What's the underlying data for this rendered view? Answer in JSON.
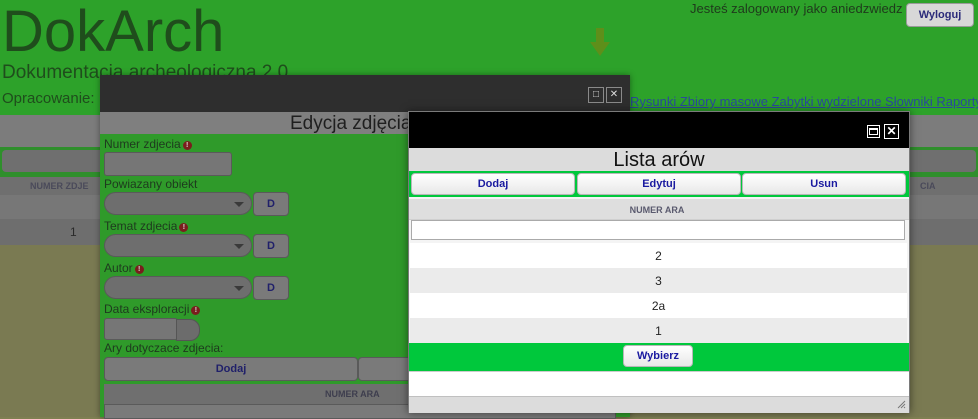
{
  "app": {
    "title": "DokArch",
    "subtitle": "Dokumentacja archeologiczna 2.0",
    "author_label": "Opracowanie:",
    "user_status": "Jesteś zalogowany jako aniedzwiedz",
    "logout_label": "Wyloguj",
    "menu_text": "Rysunki  Zbiory masowe  Zabytki wydzielone  Słowniki  Raporty"
  },
  "background_table": {
    "header_left": "NUMER ZDJE",
    "header_right": "CIA",
    "first_cell": "1"
  },
  "edit_dialog": {
    "heading": "Edycja zdjęcia",
    "fields": {
      "photo_number": "Numer zdjecia",
      "linked_object": "Powiazany obiekt",
      "photo_subject": "Temat zdjecia",
      "author": "Autor",
      "exploration_date": "Data eksploracji",
      "ars_label": "Ary dotyczace zdjecia:"
    },
    "d_button": "D",
    "add_button": "Dodaj",
    "column_header": "NUMER ARA"
  },
  "lista_dialog": {
    "heading": "Lista arów",
    "buttons": {
      "add": "Dodaj",
      "edit": "Edytuj",
      "delete": "Usun"
    },
    "column_header": "NUMER ARA",
    "filter_value": "",
    "rows": [
      "2",
      "3",
      "2a",
      "1"
    ],
    "select_button": "Wybierz"
  },
  "colors": {
    "accent_green": "#00c83c",
    "title_bar": "#000000",
    "button_text": "#1a1aa0"
  }
}
